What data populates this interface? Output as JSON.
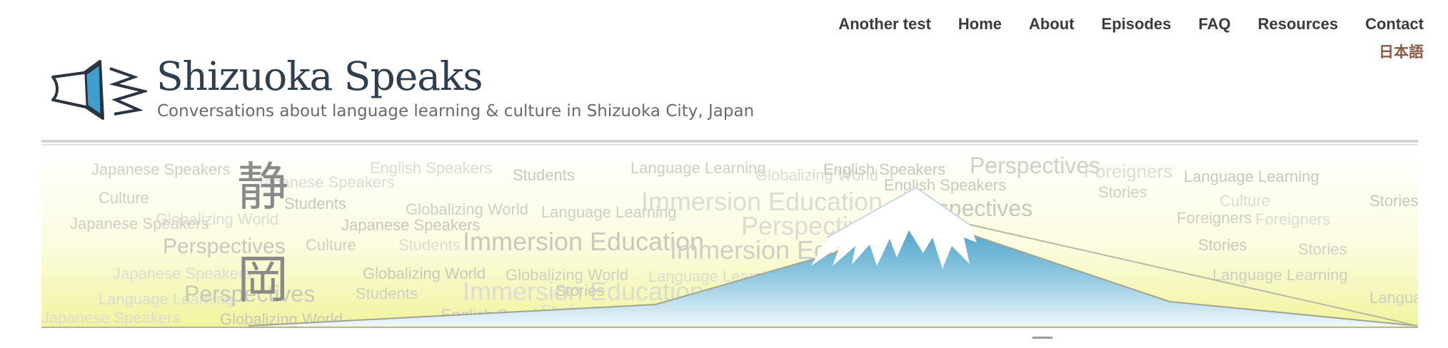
{
  "nav": {
    "items": [
      {
        "label": "Another test"
      },
      {
        "label": "Home"
      },
      {
        "label": "About"
      },
      {
        "label": "Episodes"
      },
      {
        "label": "FAQ"
      },
      {
        "label": "Resources"
      },
      {
        "label": "Contact"
      }
    ],
    "language_link": "日本語"
  },
  "header": {
    "logo_icon": "megaphone-icon",
    "title": "Shizuoka Speaks",
    "tagline": "Conversations about language learning & culture in Shizuoka City, Japan"
  },
  "banner": {
    "kanji": [
      "静",
      "岡"
    ],
    "words": [
      "Japanese Speakers",
      "English Speakers",
      "Students",
      "Language Learning",
      "Globalizing World",
      "Immersion Education",
      "Perspectives",
      "Foreigners",
      "Culture",
      "Stories"
    ],
    "colors": {
      "mountain_top": "#2f8fc0",
      "mountain_base": "#e6f3f9",
      "sky_yellow": "#f5f7a8",
      "word_gray": "#cfcfc6"
    }
  }
}
